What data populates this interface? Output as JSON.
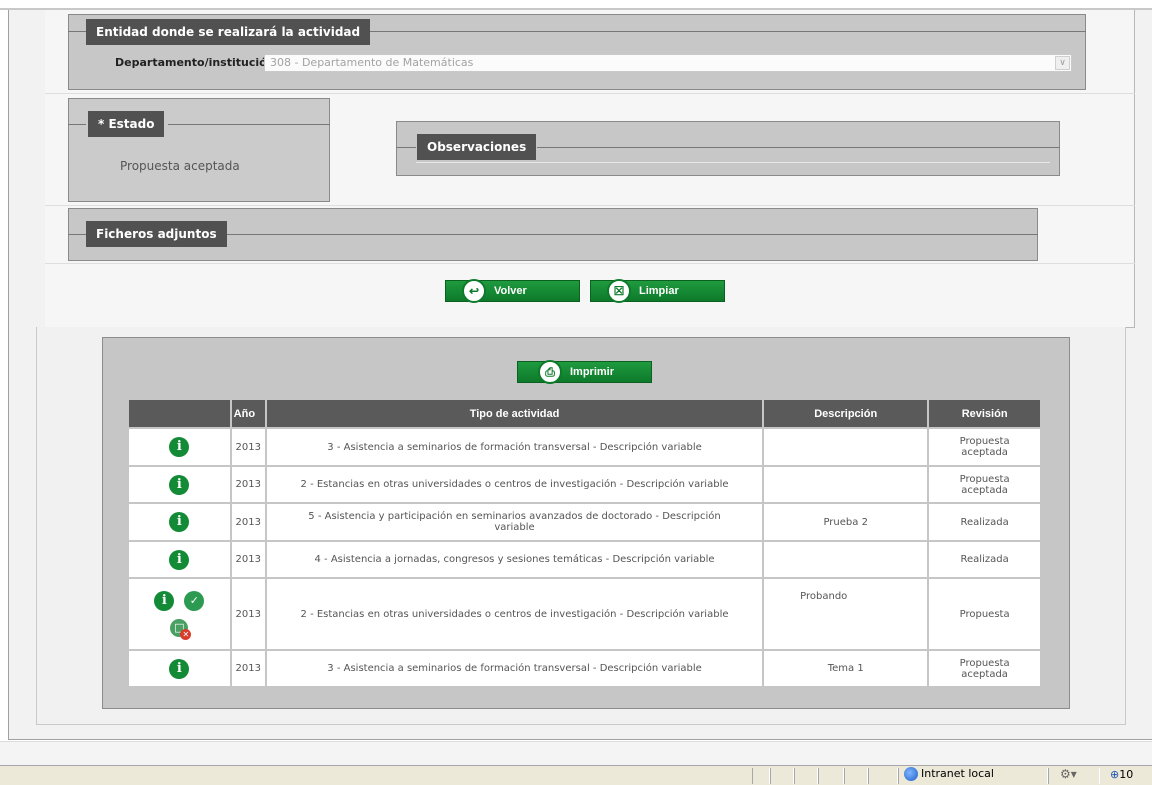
{
  "entity_section": {
    "legend": "Entidad donde se realizará la actividad",
    "dept_label": "Departamento/institución",
    "dept_value": "308 - Departamento de Matemáticas"
  },
  "estado_section": {
    "legend": "* Estado",
    "value": "Propuesta aceptada"
  },
  "observaciones_section": {
    "legend": "Observaciones"
  },
  "ficheros_section": {
    "legend": "Ficheros adjuntos"
  },
  "buttons": {
    "volver": "Volver",
    "limpiar": "Limpiar",
    "imprimir": "Imprimir"
  },
  "table": {
    "headers": [
      "",
      "Año",
      "Tipo de actividad",
      "Descripción",
      "Revisión"
    ],
    "rows": [
      {
        "year": "2013",
        "tipo": "3 - Asistencia a seminarios de formación transversal - Descripción variable",
        "descripcion": "",
        "revision": "Propuesta aceptada"
      },
      {
        "year": "2013",
        "tipo": "2 - Estancias en otras universidades o centros de investigación - Descripción variable",
        "descripcion": "",
        "revision": "Propuesta aceptada"
      },
      {
        "year": "2013",
        "tipo": "5 - Asistencia y participación en seminarios avanzados de doctorado - Descripción variable",
        "descripcion": "Prueba 2",
        "revision": "Realizada"
      },
      {
        "year": "2013",
        "tipo": "4 - Asistencia a jornadas, congresos y sesiones temáticas - Descripción variable",
        "descripcion": "",
        "revision": "Realizada"
      },
      {
        "year": "2013",
        "tipo": "2 - Estancias en otras universidades o centros de investigación - Descripción variable",
        "descripcion": "Probando",
        "revision": "Propuesta"
      },
      {
        "year": "2013",
        "tipo": "3 - Asistencia a seminarios de formación transversal - Descripción variable",
        "descripcion": "Tema 1",
        "revision": "Propuesta aceptada"
      }
    ]
  },
  "statusbar": {
    "zone": "Intranet local",
    "zoom": "10"
  },
  "icons": {
    "info": "info-icon",
    "validate": "validate-icon",
    "reject": "reject-icon",
    "back": "back-icon",
    "trash": "trash-icon",
    "print": "print-icon"
  },
  "colors": {
    "accent_green": "#0d7a2a",
    "legend_bg": "#515151",
    "section_bg": "#c7c7c7"
  }
}
